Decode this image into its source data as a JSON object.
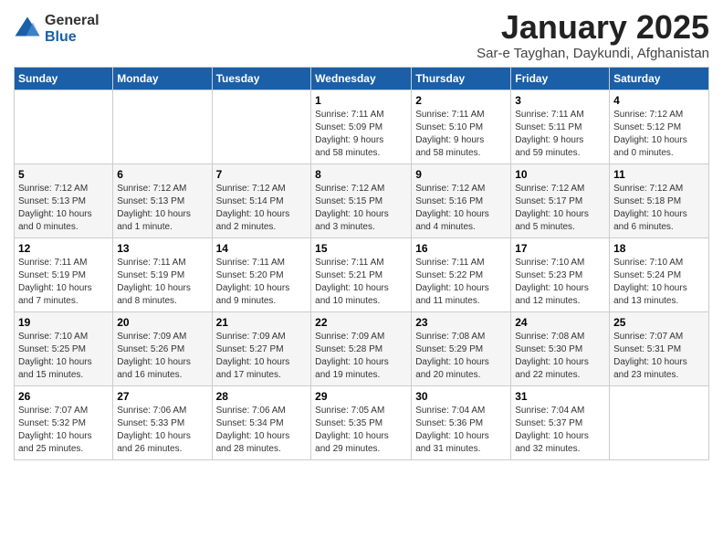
{
  "logo": {
    "general": "General",
    "blue": "Blue"
  },
  "title": "January 2025",
  "subtitle": "Sar-e Tayghan, Daykundi, Afghanistan",
  "days_of_week": [
    "Sunday",
    "Monday",
    "Tuesday",
    "Wednesday",
    "Thursday",
    "Friday",
    "Saturday"
  ],
  "weeks": [
    [
      {
        "day": "",
        "info": ""
      },
      {
        "day": "",
        "info": ""
      },
      {
        "day": "",
        "info": ""
      },
      {
        "day": "1",
        "info": "Sunrise: 7:11 AM\nSunset: 5:09 PM\nDaylight: 9 hours\nand 58 minutes."
      },
      {
        "day": "2",
        "info": "Sunrise: 7:11 AM\nSunset: 5:10 PM\nDaylight: 9 hours\nand 58 minutes."
      },
      {
        "day": "3",
        "info": "Sunrise: 7:11 AM\nSunset: 5:11 PM\nDaylight: 9 hours\nand 59 minutes."
      },
      {
        "day": "4",
        "info": "Sunrise: 7:12 AM\nSunset: 5:12 PM\nDaylight: 10 hours\nand 0 minutes."
      }
    ],
    [
      {
        "day": "5",
        "info": "Sunrise: 7:12 AM\nSunset: 5:13 PM\nDaylight: 10 hours\nand 0 minutes."
      },
      {
        "day": "6",
        "info": "Sunrise: 7:12 AM\nSunset: 5:13 PM\nDaylight: 10 hours\nand 1 minute."
      },
      {
        "day": "7",
        "info": "Sunrise: 7:12 AM\nSunset: 5:14 PM\nDaylight: 10 hours\nand 2 minutes."
      },
      {
        "day": "8",
        "info": "Sunrise: 7:12 AM\nSunset: 5:15 PM\nDaylight: 10 hours\nand 3 minutes."
      },
      {
        "day": "9",
        "info": "Sunrise: 7:12 AM\nSunset: 5:16 PM\nDaylight: 10 hours\nand 4 minutes."
      },
      {
        "day": "10",
        "info": "Sunrise: 7:12 AM\nSunset: 5:17 PM\nDaylight: 10 hours\nand 5 minutes."
      },
      {
        "day": "11",
        "info": "Sunrise: 7:12 AM\nSunset: 5:18 PM\nDaylight: 10 hours\nand 6 minutes."
      }
    ],
    [
      {
        "day": "12",
        "info": "Sunrise: 7:11 AM\nSunset: 5:19 PM\nDaylight: 10 hours\nand 7 minutes."
      },
      {
        "day": "13",
        "info": "Sunrise: 7:11 AM\nSunset: 5:19 PM\nDaylight: 10 hours\nand 8 minutes."
      },
      {
        "day": "14",
        "info": "Sunrise: 7:11 AM\nSunset: 5:20 PM\nDaylight: 10 hours\nand 9 minutes."
      },
      {
        "day": "15",
        "info": "Sunrise: 7:11 AM\nSunset: 5:21 PM\nDaylight: 10 hours\nand 10 minutes."
      },
      {
        "day": "16",
        "info": "Sunrise: 7:11 AM\nSunset: 5:22 PM\nDaylight: 10 hours\nand 11 minutes."
      },
      {
        "day": "17",
        "info": "Sunrise: 7:10 AM\nSunset: 5:23 PM\nDaylight: 10 hours\nand 12 minutes."
      },
      {
        "day": "18",
        "info": "Sunrise: 7:10 AM\nSunset: 5:24 PM\nDaylight: 10 hours\nand 13 minutes."
      }
    ],
    [
      {
        "day": "19",
        "info": "Sunrise: 7:10 AM\nSunset: 5:25 PM\nDaylight: 10 hours\nand 15 minutes."
      },
      {
        "day": "20",
        "info": "Sunrise: 7:09 AM\nSunset: 5:26 PM\nDaylight: 10 hours\nand 16 minutes."
      },
      {
        "day": "21",
        "info": "Sunrise: 7:09 AM\nSunset: 5:27 PM\nDaylight: 10 hours\nand 17 minutes."
      },
      {
        "day": "22",
        "info": "Sunrise: 7:09 AM\nSunset: 5:28 PM\nDaylight: 10 hours\nand 19 minutes."
      },
      {
        "day": "23",
        "info": "Sunrise: 7:08 AM\nSunset: 5:29 PM\nDaylight: 10 hours\nand 20 minutes."
      },
      {
        "day": "24",
        "info": "Sunrise: 7:08 AM\nSunset: 5:30 PM\nDaylight: 10 hours\nand 22 minutes."
      },
      {
        "day": "25",
        "info": "Sunrise: 7:07 AM\nSunset: 5:31 PM\nDaylight: 10 hours\nand 23 minutes."
      }
    ],
    [
      {
        "day": "26",
        "info": "Sunrise: 7:07 AM\nSunset: 5:32 PM\nDaylight: 10 hours\nand 25 minutes."
      },
      {
        "day": "27",
        "info": "Sunrise: 7:06 AM\nSunset: 5:33 PM\nDaylight: 10 hours\nand 26 minutes."
      },
      {
        "day": "28",
        "info": "Sunrise: 7:06 AM\nSunset: 5:34 PM\nDaylight: 10 hours\nand 28 minutes."
      },
      {
        "day": "29",
        "info": "Sunrise: 7:05 AM\nSunset: 5:35 PM\nDaylight: 10 hours\nand 29 minutes."
      },
      {
        "day": "30",
        "info": "Sunrise: 7:04 AM\nSunset: 5:36 PM\nDaylight: 10 hours\nand 31 minutes."
      },
      {
        "day": "31",
        "info": "Sunrise: 7:04 AM\nSunset: 5:37 PM\nDaylight: 10 hours\nand 32 minutes."
      },
      {
        "day": "",
        "info": ""
      }
    ]
  ]
}
